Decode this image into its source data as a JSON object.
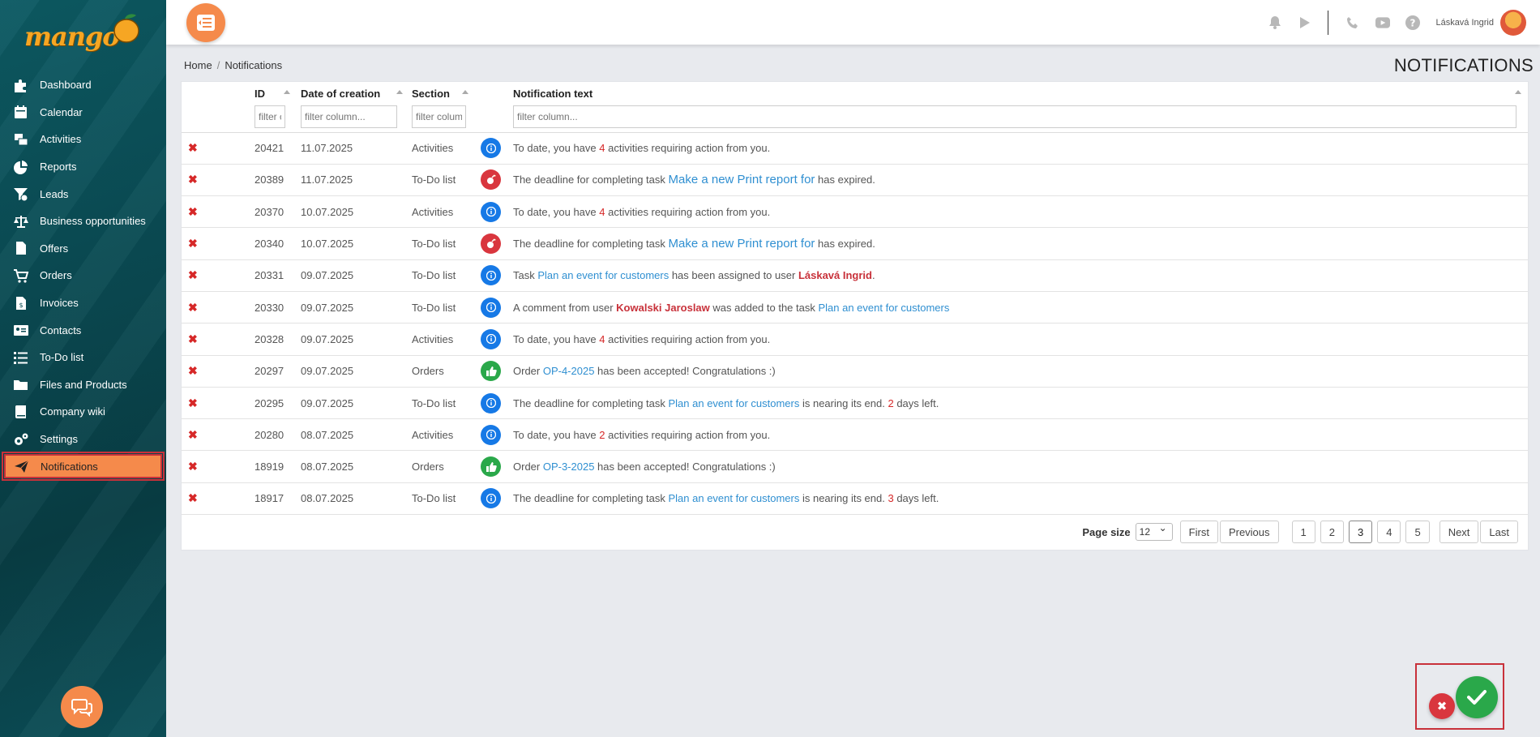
{
  "brand": {
    "logo_text": "mango"
  },
  "sidebar": {
    "items": [
      {
        "label": "Dashboard",
        "icon": "puzzle-icon"
      },
      {
        "label": "Calendar",
        "icon": "calendar-icon"
      },
      {
        "label": "Activities",
        "icon": "activities-icon"
      },
      {
        "label": "Reports",
        "icon": "pie-chart-icon"
      },
      {
        "label": "Leads",
        "icon": "funnel-icon"
      },
      {
        "label": "Business opportunities",
        "icon": "scale-icon"
      },
      {
        "label": "Offers",
        "icon": "document-icon"
      },
      {
        "label": "Orders",
        "icon": "cart-icon"
      },
      {
        "label": "Invoices",
        "icon": "invoice-icon"
      },
      {
        "label": "Contacts",
        "icon": "contact-card-icon"
      },
      {
        "label": "To-Do list",
        "icon": "list-icon"
      },
      {
        "label": "Files and Products",
        "icon": "folder-icon"
      },
      {
        "label": "Company wiki",
        "icon": "book-icon"
      },
      {
        "label": "Settings",
        "icon": "gears-icon"
      },
      {
        "label": "Notifications",
        "icon": "paper-plane-icon",
        "active": true
      }
    ]
  },
  "topbar": {
    "user_name": "Láskavá Ingrid",
    "icons": [
      "bell-icon",
      "play-icon",
      "phone-icon",
      "youtube-icon",
      "help-icon"
    ]
  },
  "breadcrumb": {
    "home": "Home",
    "separator": "/",
    "current": "Notifications"
  },
  "page_title": "NOTIFICATIONS",
  "table": {
    "columns": {
      "id": "ID",
      "date": "Date of creation",
      "section": "Section",
      "text": "Notification text"
    },
    "filters": {
      "id": "filter column...",
      "date": "filter column...",
      "section": "filter column...",
      "text": "filter column..."
    },
    "delete_glyph": "✖",
    "rows": [
      {
        "id": "20421",
        "date": "11.07.2025",
        "section": "Activities",
        "badge": "info",
        "parts": [
          {
            "t": "To date, you have "
          },
          {
            "t": "4",
            "c": "red"
          },
          {
            "t": " activities requiring action from you."
          }
        ]
      },
      {
        "id": "20389",
        "date": "11.07.2025",
        "section": "To-Do list",
        "badge": "warn",
        "parts": [
          {
            "t": "The deadline for completing task "
          },
          {
            "t": "Make a new Print report for",
            "c": "lnk-big"
          },
          {
            "t": "  has expired."
          }
        ]
      },
      {
        "id": "20370",
        "date": "10.07.2025",
        "section": "Activities",
        "badge": "info",
        "parts": [
          {
            "t": "To date, you have "
          },
          {
            "t": "4",
            "c": "red"
          },
          {
            "t": " activities requiring action from you."
          }
        ]
      },
      {
        "id": "20340",
        "date": "10.07.2025",
        "section": "To-Do list",
        "badge": "warn",
        "parts": [
          {
            "t": "The deadline for completing task "
          },
          {
            "t": "Make a new Print report for",
            "c": "lnk-big"
          },
          {
            "t": "  has expired."
          }
        ]
      },
      {
        "id": "20331",
        "date": "09.07.2025",
        "section": "To-Do list",
        "badge": "info",
        "parts": [
          {
            "t": "Task "
          },
          {
            "t": "Plan an event for customers",
            "c": "lnk"
          },
          {
            "t": " has been assigned to user "
          },
          {
            "t": "Láskavá Ingrid",
            "c": "user"
          },
          {
            "t": "."
          }
        ]
      },
      {
        "id": "20330",
        "date": "09.07.2025",
        "section": "To-Do list",
        "badge": "info",
        "parts": [
          {
            "t": "A comment from user "
          },
          {
            "t": "Kowalski Jaroslaw",
            "c": "user"
          },
          {
            "t": " was added to the task "
          },
          {
            "t": "Plan an event for customers",
            "c": "lnk"
          }
        ]
      },
      {
        "id": "20328",
        "date": "09.07.2025",
        "section": "Activities",
        "badge": "info",
        "parts": [
          {
            "t": "To date, you have "
          },
          {
            "t": "4",
            "c": "red"
          },
          {
            "t": " activities requiring action from you."
          }
        ]
      },
      {
        "id": "20297",
        "date": "09.07.2025",
        "section": "Orders",
        "badge": "ok",
        "parts": [
          {
            "t": "Order "
          },
          {
            "t": "OP-4-2025",
            "c": "lnk"
          },
          {
            "t": " has been accepted! Congratulations :)"
          }
        ]
      },
      {
        "id": "20295",
        "date": "09.07.2025",
        "section": "To-Do list",
        "badge": "info",
        "parts": [
          {
            "t": "The deadline for completing task "
          },
          {
            "t": "Plan an event for customers",
            "c": "lnk"
          },
          {
            "t": " is nearing its end. "
          },
          {
            "t": "2",
            "c": "red"
          },
          {
            "t": " days left."
          }
        ]
      },
      {
        "id": "20280",
        "date": "08.07.2025",
        "section": "Activities",
        "badge": "info",
        "parts": [
          {
            "t": "To date, you have "
          },
          {
            "t": "2",
            "c": "red"
          },
          {
            "t": " activities requiring action from you."
          }
        ]
      },
      {
        "id": "18919",
        "date": "08.07.2025",
        "section": "Orders",
        "badge": "ok",
        "parts": [
          {
            "t": "Order "
          },
          {
            "t": "OP-3-2025",
            "c": "lnk"
          },
          {
            "t": " has been accepted! Congratulations :)"
          }
        ]
      },
      {
        "id": "18917",
        "date": "08.07.2025",
        "section": "To-Do list",
        "badge": "info",
        "parts": [
          {
            "t": "The deadline for completing task "
          },
          {
            "t": "Plan an event for customers",
            "c": "lnk"
          },
          {
            "t": " is nearing its end. "
          },
          {
            "t": "3",
            "c": "red"
          },
          {
            "t": " days left."
          }
        ]
      }
    ]
  },
  "pagination": {
    "page_size_label": "Page size",
    "page_size_value": "12",
    "first": "First",
    "previous": "Previous",
    "pages": [
      "1",
      "2",
      "3",
      "4",
      "5"
    ],
    "current_page": "3",
    "next": "Next",
    "last": "Last"
  },
  "actions": {
    "cancel_glyph": "✖"
  },
  "colors": {
    "accent": "#f58a4b",
    "sidebar": "#0a4a52",
    "info": "#1679e6",
    "warn": "#d9363e",
    "ok": "#2aa84a",
    "link": "#2f8fd1"
  }
}
